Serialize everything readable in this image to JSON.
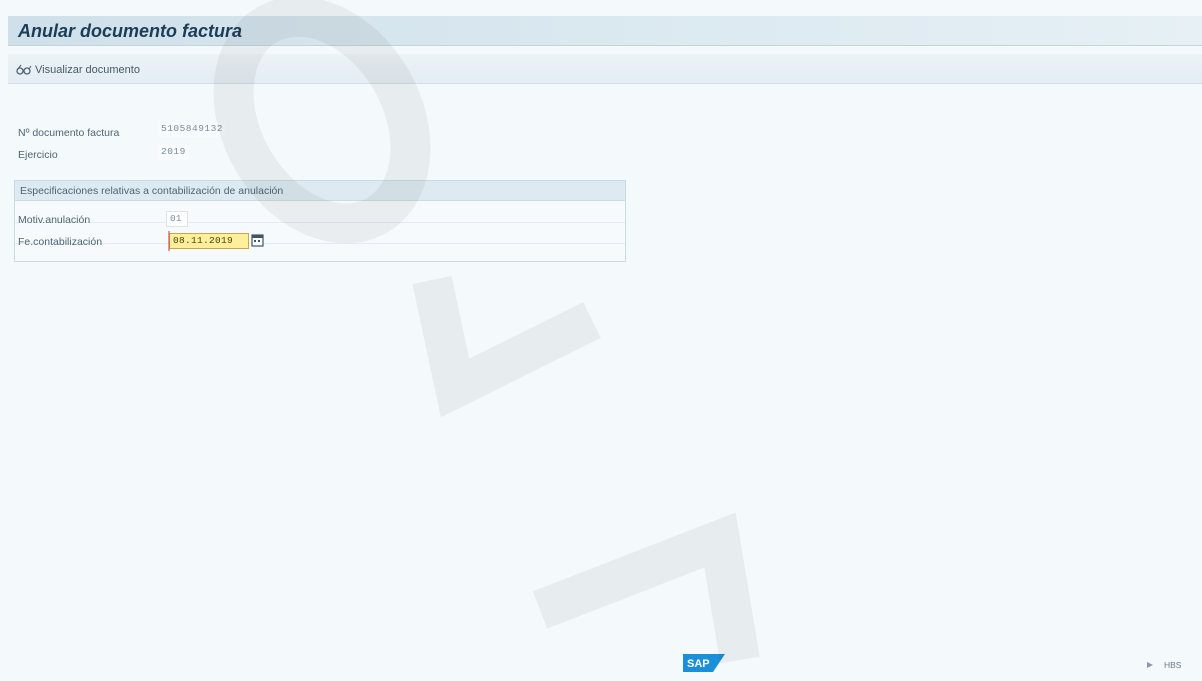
{
  "window": {
    "title": "Anular documento factura"
  },
  "toolbar": {
    "display_document_label": "Visualizar documento",
    "display_document_icon": "glasses-icon"
  },
  "header_fields": {
    "invoice_number_label": "Nº documento factura",
    "invoice_number_value": "5105849132",
    "fiscal_year_label": "Ejercicio",
    "fiscal_year_value": "2019"
  },
  "reversal_group": {
    "title": "Especificaciones relativas a contabilización de anulación",
    "reason_label": "Motiv.anulación",
    "reason_value": "01",
    "posting_date_label": "Fe.contabilización",
    "posting_date_value": "08.11.2019",
    "calendar_icon": "calendar-icon"
  },
  "footer": {
    "logo_text": "SAP",
    "system_text": "HBS"
  },
  "watermark": {
    "letters": [
      "O",
      "N",
      "A"
    ]
  },
  "colors": {
    "background": "#f4f9fc",
    "title_bar": "#d8e7ef",
    "title_text": "#1c3d58",
    "date_field_highlight": "#ffef9a",
    "sap_logo": "#1b8fd8"
  }
}
